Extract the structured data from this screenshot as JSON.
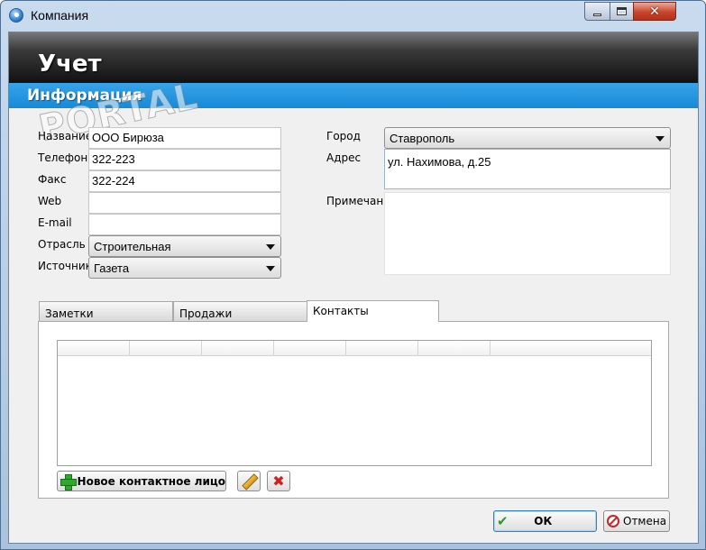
{
  "window": {
    "title": "Компания"
  },
  "header": {
    "banner_title": "Учет",
    "section_title": "Информация"
  },
  "watermark": {
    "text": "PORTAL"
  },
  "form": {
    "name": {
      "label": "Название",
      "value": "ООО Бирюза"
    },
    "phone": {
      "label": "Телефон",
      "value": "322-223"
    },
    "fax": {
      "label": "Факс",
      "value": "322-224"
    },
    "web": {
      "label": "Web",
      "value": ""
    },
    "email": {
      "label": "E-mail",
      "value": ""
    },
    "industry": {
      "label": "Отрасль",
      "value": "Строительная"
    },
    "source": {
      "label": "Источник",
      "value": "Газета"
    },
    "city": {
      "label": "Город",
      "value": "Ставрополь"
    },
    "address": {
      "label": "Адрес",
      "value": "ул. Нахимова, д.25"
    },
    "notes": {
      "label": "Примечани",
      "value": ""
    }
  },
  "tabs": [
    {
      "label": "Заметки",
      "active": false
    },
    {
      "label": "Продажи",
      "active": false
    },
    {
      "label": "Контакты",
      "active": true
    }
  ],
  "contacts": {
    "new_button": "Новое контактное лицо"
  },
  "footer": {
    "ok_label": "ОК",
    "cancel_label": "Отмена"
  },
  "colors": {
    "accent_blue": "#1e90dd",
    "banner_dark": "#1a1a1a",
    "close_red": "#c9452c"
  }
}
